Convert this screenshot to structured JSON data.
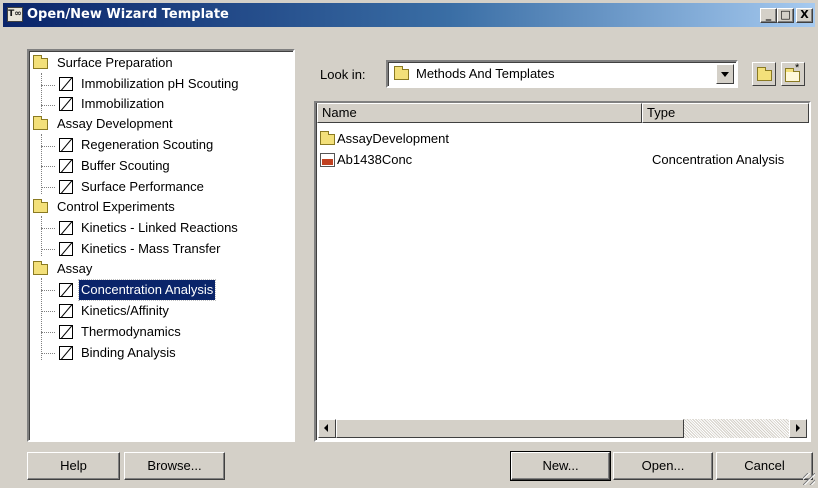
{
  "window": {
    "title": "Open/New Wizard Template",
    "app_icon_text": "T∞"
  },
  "titlebar_buttons": {
    "minimize": "_",
    "maximize": "□",
    "close": "X"
  },
  "tree": {
    "groups": [
      {
        "label": "Surface Preparation",
        "items": [
          "Immobilization pH Scouting",
          "Immobilization"
        ]
      },
      {
        "label": "Assay Development",
        "items": [
          "Regeneration Scouting",
          "Buffer Scouting",
          "Surface Performance"
        ]
      },
      {
        "label": "Control Experiments",
        "items": [
          "Kinetics - Linked Reactions",
          "Kinetics - Mass Transfer"
        ]
      },
      {
        "label": "Assay",
        "items": [
          "Concentration Analysis",
          "Kinetics/Affinity",
          "Thermodynamics",
          "Binding Analysis"
        ]
      }
    ],
    "selected": "Concentration Analysis"
  },
  "lookin": {
    "label": "Look in:",
    "value": "Methods And Templates"
  },
  "filelist": {
    "columns": [
      "Name",
      "Type"
    ],
    "rows": [
      {
        "name": "AssayDevelopment",
        "type": "",
        "icon": "folder-icon"
      },
      {
        "name": "Ab1438Conc",
        "type": "Concentration Analysis",
        "icon": "method-file-icon"
      }
    ]
  },
  "buttons": {
    "help": "Help",
    "browse": "Browse...",
    "new": "New...",
    "open": "Open...",
    "cancel": "Cancel"
  },
  "colors": {
    "title_start": "#0a246a",
    "title_end": "#a6caf0",
    "selection": "#0a246a",
    "face": "#d4d0c8"
  }
}
